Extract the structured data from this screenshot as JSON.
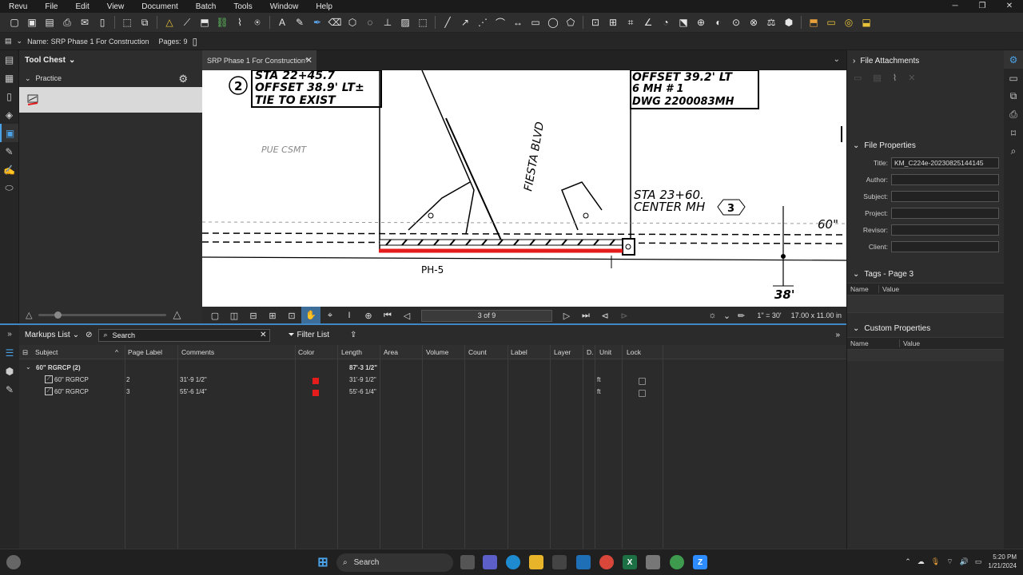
{
  "menu": [
    "Revu",
    "File",
    "Edit",
    "View",
    "Document",
    "Batch",
    "Tools",
    "Window",
    "Help"
  ],
  "docbar": {
    "name_label": "Name:",
    "name": "SRP Phase 1 For Construction",
    "pages_label": "Pages:",
    "pages": "9"
  },
  "toolchest": {
    "title": "Tool Chest",
    "section": "Practice"
  },
  "tab": {
    "label": "SRP Phase 1 For Construction*"
  },
  "drawing": {
    "t1": "STA 22+45.7",
    "t2": "OFFSET 38.9' LT±",
    "t3": "TIE TO EXIST",
    "t4": "OFFSET 39.2' LT",
    "t5": "6 MH # 1",
    "t6": "DWG 2200083MH",
    "t7": "FIESTA BLVD",
    "t8": "STA 23+60.",
    "t9": "CENTER MH",
    "t10": "60\"",
    "t11": "38'",
    "t12": "PH-5",
    "t13": "PUE CSMT",
    "c1": "2",
    "c2": "3"
  },
  "nav": {
    "page": "3 of 9",
    "scale": "1\" = 30'",
    "size": "17.00 x 11.00 in"
  },
  "markups": {
    "title": "Markups List",
    "search_placeholder": "Search",
    "filter": "Filter List",
    "columns": [
      "Subject",
      "Page Label",
      "Comments",
      "Color",
      "Length",
      "Area",
      "Volume",
      "Count",
      "Label",
      "Layer",
      "D.",
      "Unit",
      "Lock"
    ],
    "group": {
      "subject": "60\" RGRCP (2)",
      "length": "87'-3 1/2\""
    },
    "rows": [
      {
        "subject": "60\" RGRCP",
        "page": "2",
        "comments": "31'-9 1/2\"",
        "color": "#e41c1c",
        "length": "31'-9 1/2\"",
        "unit": "ft"
      },
      {
        "subject": "60\" RGRCP",
        "page": "3",
        "comments": "55'-6 1/4\"",
        "color": "#e41c1c",
        "length": "55'-6 1/4\"",
        "unit": "ft"
      }
    ]
  },
  "right": {
    "attachments": "File Attachments",
    "properties": "File Properties",
    "props": [
      {
        "label": "Title:",
        "value": "KM_C224e-20230825144145"
      },
      {
        "label": "Author:",
        "value": ""
      },
      {
        "label": "Subject:",
        "value": ""
      },
      {
        "label": "Project:",
        "value": ""
      },
      {
        "label": "Revisor:",
        "value": ""
      },
      {
        "label": "Client:",
        "value": ""
      }
    ],
    "tags": "Tags - Page 3",
    "custom": "Custom Properties",
    "name_col": "Name",
    "value_col": "Value"
  },
  "taskbar": {
    "search": "Search",
    "time": "5:20 PM",
    "date": "1/21/2024"
  },
  "colors": {
    "accent": "#3f87c5",
    "markup": "#e41c1c"
  }
}
